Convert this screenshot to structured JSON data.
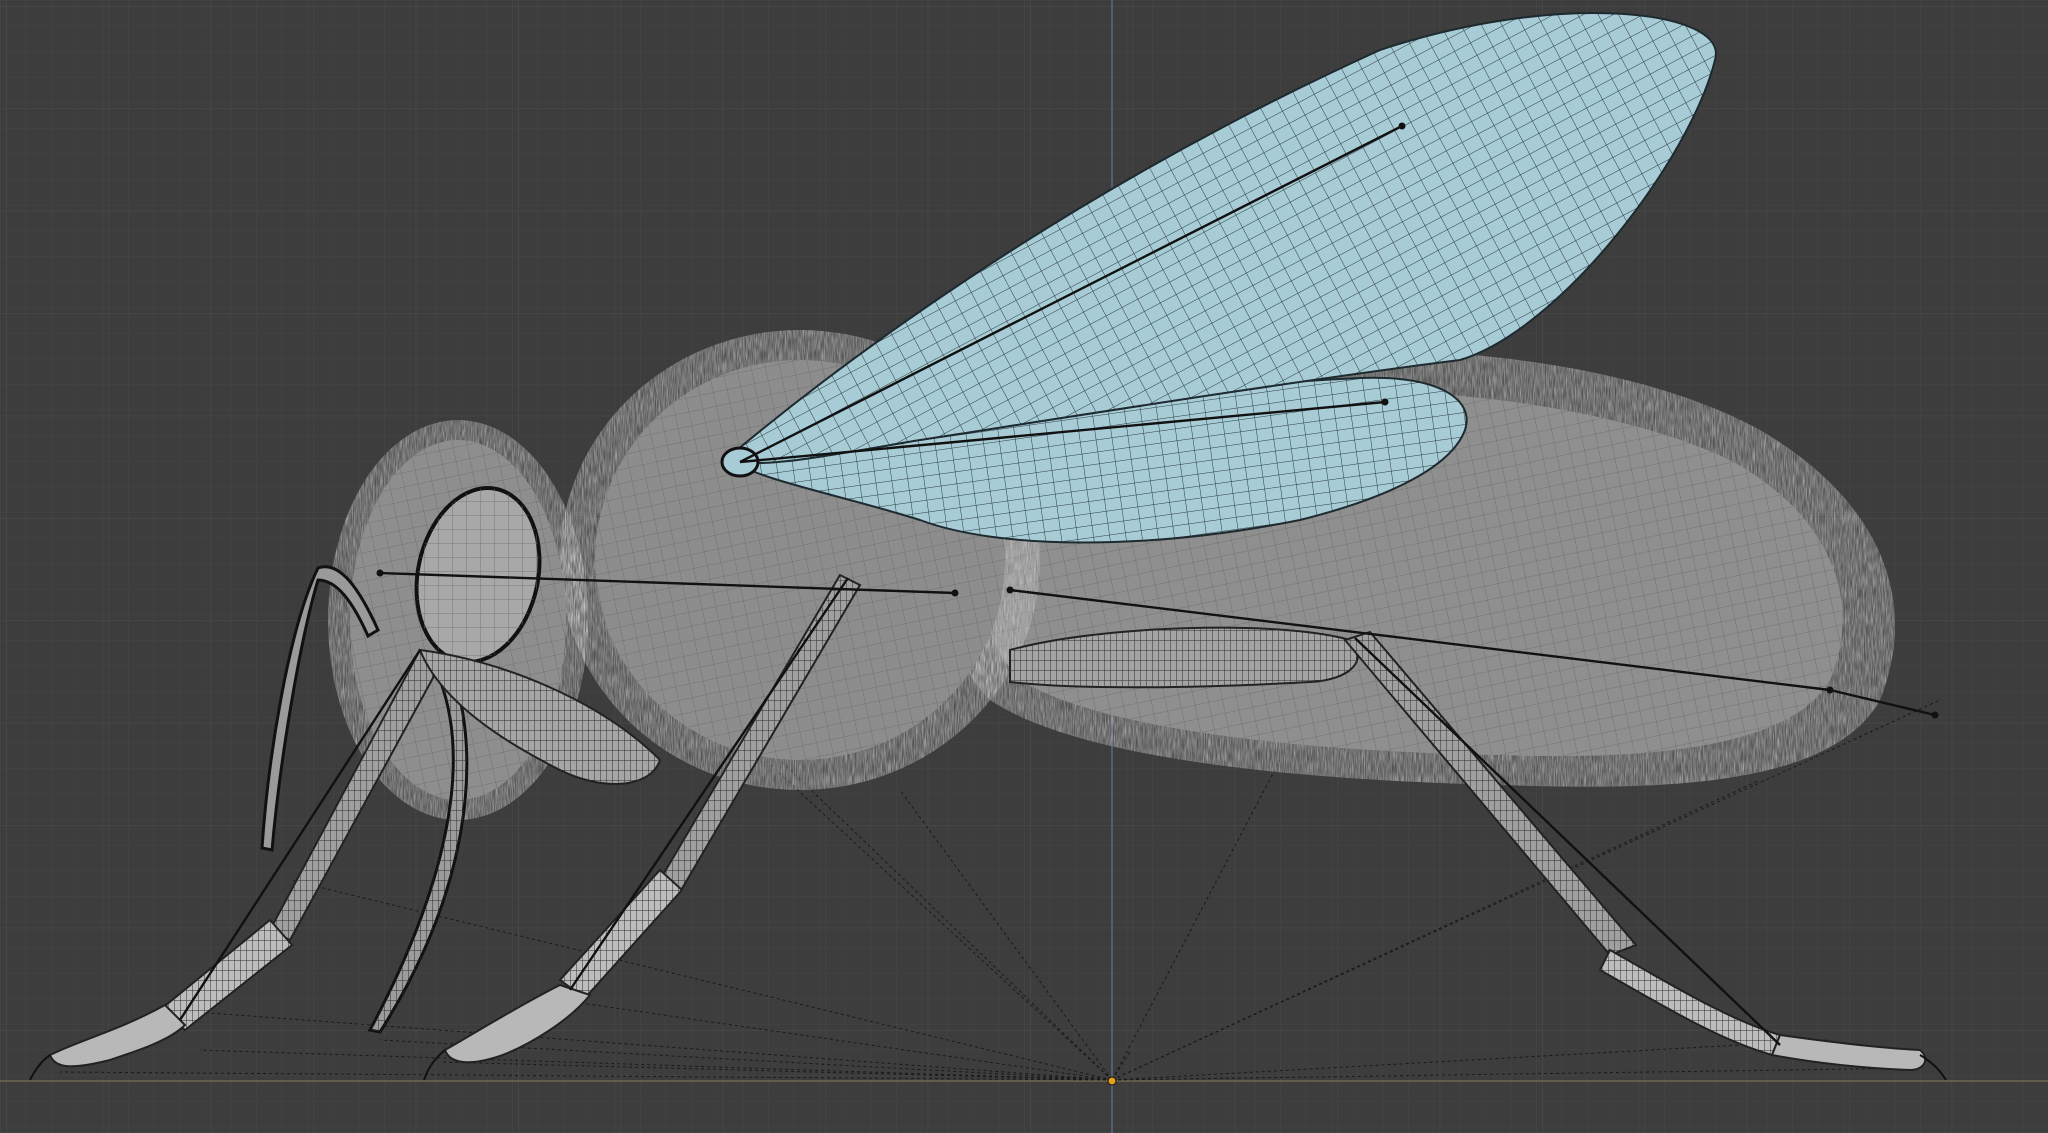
{
  "viewport": {
    "view_label": "",
    "background_color": "#3d3d3d",
    "grid_minor_color": "#454545",
    "grid_major_color": "#4a4a4a",
    "axis_z_color": "#5a6a88",
    "ground_line_color": "#6f6a4e",
    "origin_color": "#e6a11a"
  },
  "model": {
    "name": "",
    "wing_color": "#a8ccd6",
    "wire_color": "#1f1f1f",
    "body_color": "#9a9a9a",
    "fur_color": "#cfcfcf",
    "bone_color": "#111111"
  }
}
